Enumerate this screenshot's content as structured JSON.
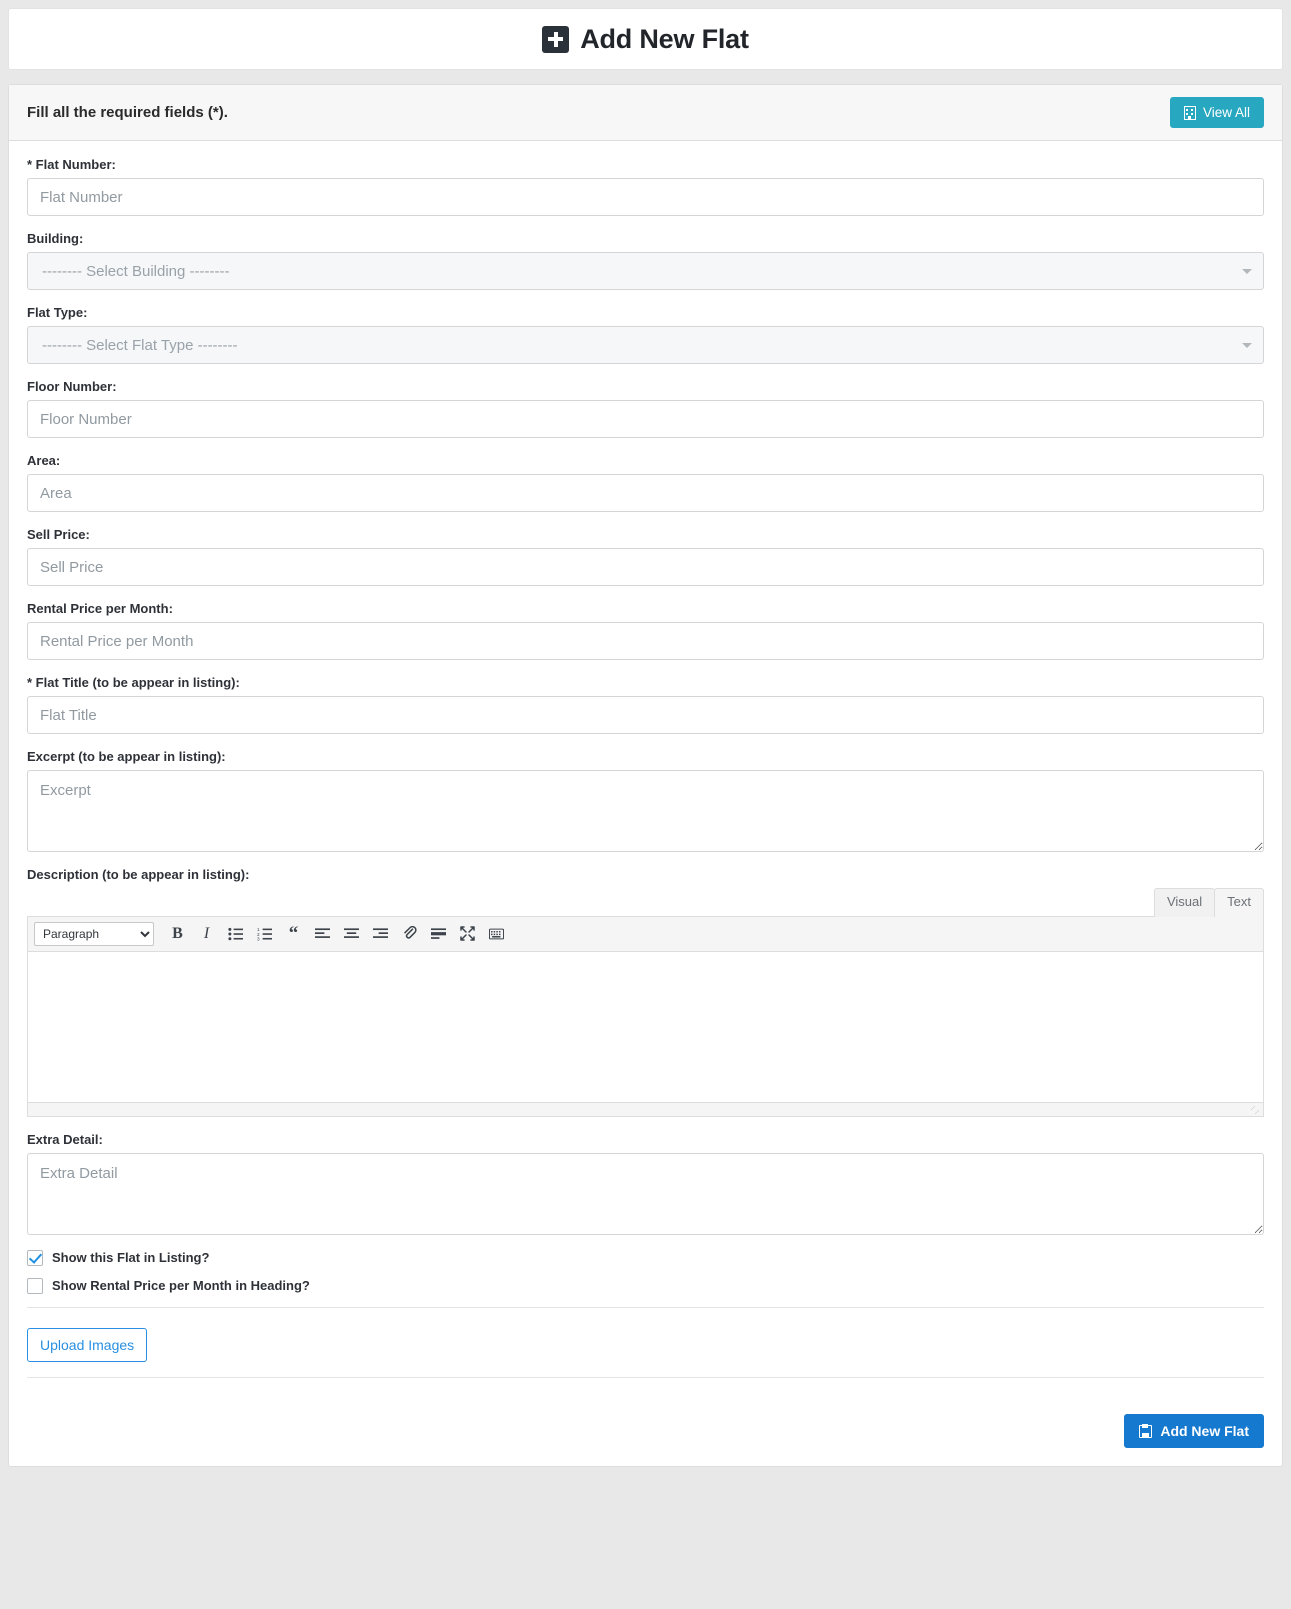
{
  "header": {
    "title": "Add New Flat",
    "icon": "plus-square-icon"
  },
  "card": {
    "instruction": "Fill all the required fields (*).",
    "view_all_label": "View All",
    "view_all_icon": "building-icon",
    "accent_teal": "#28a7c0",
    "accent_blue": "#1579d0"
  },
  "fields": {
    "flat_number": {
      "label": "* Flat Number:",
      "placeholder": "Flat Number",
      "value": ""
    },
    "building": {
      "label": "Building:",
      "selected": "-------- Select Building --------"
    },
    "flat_type": {
      "label": "Flat Type:",
      "selected": "-------- Select Flat Type --------"
    },
    "floor_number": {
      "label": "Floor Number:",
      "placeholder": "Floor Number",
      "value": ""
    },
    "area": {
      "label": "Area:",
      "placeholder": "Area",
      "value": ""
    },
    "sell_price": {
      "label": "Sell Price:",
      "placeholder": "Sell Price",
      "value": ""
    },
    "rental_price": {
      "label": "Rental Price per Month:",
      "placeholder": "Rental Price per Month",
      "value": ""
    },
    "flat_title": {
      "label": "* Flat Title (to be appear in listing):",
      "placeholder": "Flat Title",
      "value": ""
    },
    "excerpt": {
      "label": "Excerpt (to be appear in listing):",
      "placeholder": "Excerpt",
      "value": ""
    },
    "description": {
      "label": "Description (to be appear in listing):",
      "value": ""
    },
    "extra_detail": {
      "label": "Extra Detail:",
      "placeholder": "Extra Detail",
      "value": ""
    }
  },
  "editor": {
    "tab_visual": "Visual",
    "tab_text": "Text",
    "active_tab": "Text",
    "format_selected": "Paragraph",
    "toolbar": [
      {
        "name": "bold-icon",
        "label": "B"
      },
      {
        "name": "italic-icon",
        "label": "I"
      },
      {
        "name": "bulleted-list-icon",
        "label": ""
      },
      {
        "name": "numbered-list-icon",
        "label": ""
      },
      {
        "name": "blockquote-icon",
        "label": "“"
      },
      {
        "name": "align-left-icon",
        "label": ""
      },
      {
        "name": "align-center-icon",
        "label": ""
      },
      {
        "name": "align-right-icon",
        "label": ""
      },
      {
        "name": "insert-link-icon",
        "label": ""
      },
      {
        "name": "insert-read-more-icon",
        "label": ""
      },
      {
        "name": "fullscreen-icon",
        "label": ""
      },
      {
        "name": "keyboard-shortcuts-icon",
        "label": ""
      }
    ]
  },
  "checkboxes": {
    "show_in_listing": {
      "label": "Show this Flat in Listing?",
      "checked": true
    },
    "show_rental_price": {
      "label": "Show Rental Price per Month in Heading?",
      "checked": false
    }
  },
  "buttons": {
    "upload_images": "Upload Images",
    "submit": "Add New Flat",
    "submit_icon": "save-icon"
  }
}
